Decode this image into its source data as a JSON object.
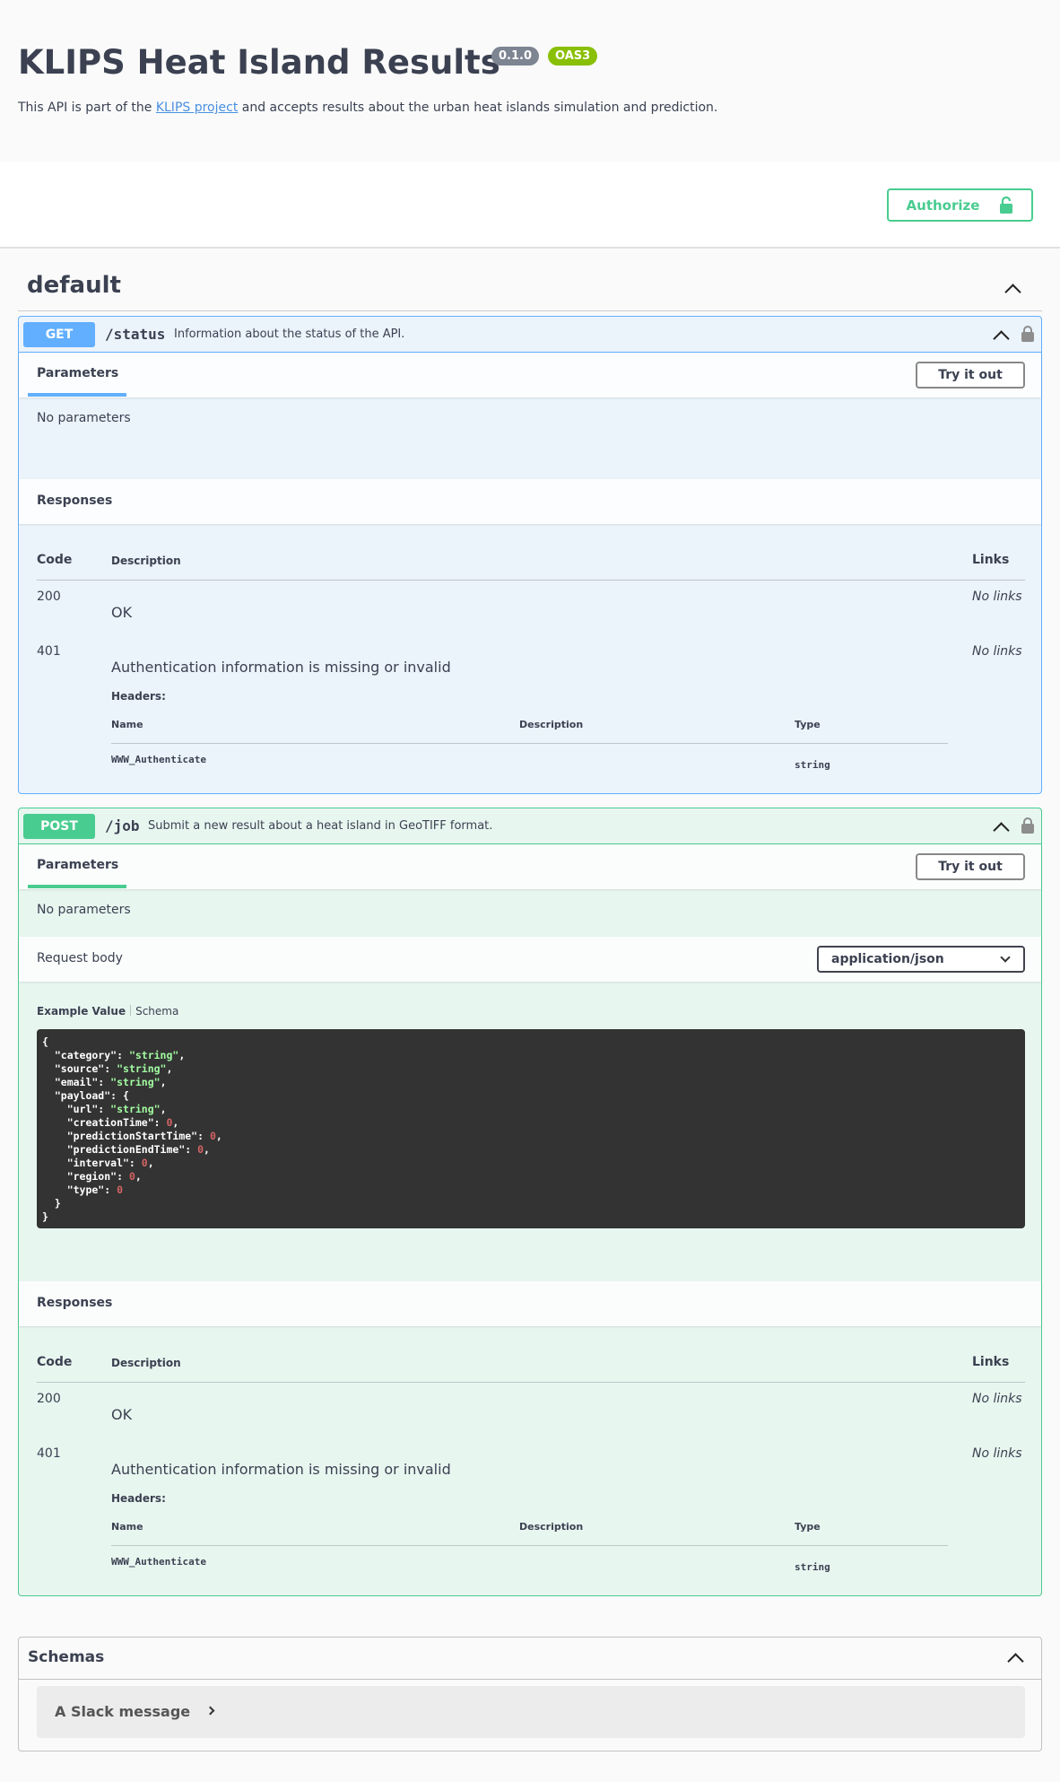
{
  "info": {
    "title": "KLIPS Heat Island Results",
    "version": "0.1.0",
    "oas": "OAS3",
    "desc_before": "This API is part of the ",
    "desc_link": "KLIPS project",
    "desc_after": " and accepts results about the urban heat islands simulation and prediction."
  },
  "auth": {
    "label": "Authorize"
  },
  "tag": {
    "name": "default"
  },
  "operations": [
    {
      "method": "GET",
      "path": "/status",
      "summary": "Information about the status of the API.",
      "params_tab": "Parameters",
      "try_label": "Try it out",
      "no_params": "No parameters",
      "responses_title": "Responses",
      "col_code": "Code",
      "col_desc": "Description",
      "col_links": "Links",
      "responses": [
        {
          "code": "200",
          "description": "OK",
          "links": "No links"
        },
        {
          "code": "401",
          "description": "Authentication information is missing or invalid",
          "links": "No links",
          "headers_label": "Headers:",
          "hdr_col_name": "Name",
          "hdr_col_desc": "Description",
          "hdr_col_type": "Type",
          "header_name": "WWW_Authenticate",
          "header_type": "string"
        }
      ]
    },
    {
      "method": "POST",
      "path": "/job",
      "summary": "Submit a new result about a heat island in GeoTIFF format.",
      "params_tab": "Parameters",
      "try_label": "Try it out",
      "no_params": "No parameters",
      "request_body_label": "Request body",
      "content_type": "application/json",
      "example_tab": "Example Value",
      "schema_tab": "Schema",
      "example_json": [
        "{",
        "  \"category\": \"string\",",
        "  \"source\": \"string\",",
        "  \"email\": \"string\",",
        "  \"payload\": {",
        "    \"url\": \"string\",",
        "    \"creationTime\": 0,",
        "    \"predictionStartTime\": 0,",
        "    \"predictionEndTime\": 0,",
        "    \"interval\": 0,",
        "    \"region\": 0,",
        "    \"type\": 0",
        "  }",
        "}"
      ],
      "responses_title": "Responses",
      "col_code": "Code",
      "col_desc": "Description",
      "col_links": "Links",
      "responses": [
        {
          "code": "200",
          "description": "OK",
          "links": "No links"
        },
        {
          "code": "401",
          "description": "Authentication information is missing or invalid",
          "links": "No links",
          "headers_label": "Headers:",
          "hdr_col_name": "Name",
          "hdr_col_desc": "Description",
          "hdr_col_type": "Type",
          "header_name": "WWW_Authenticate",
          "header_type": "string"
        }
      ]
    }
  ],
  "schemas": {
    "title": "Schemas",
    "models": [
      "A Slack message"
    ]
  },
  "colors": {
    "get": "#61affe",
    "post": "#49cc90",
    "version_badge": "#7d8492",
    "oas_badge": "#89bf04"
  }
}
